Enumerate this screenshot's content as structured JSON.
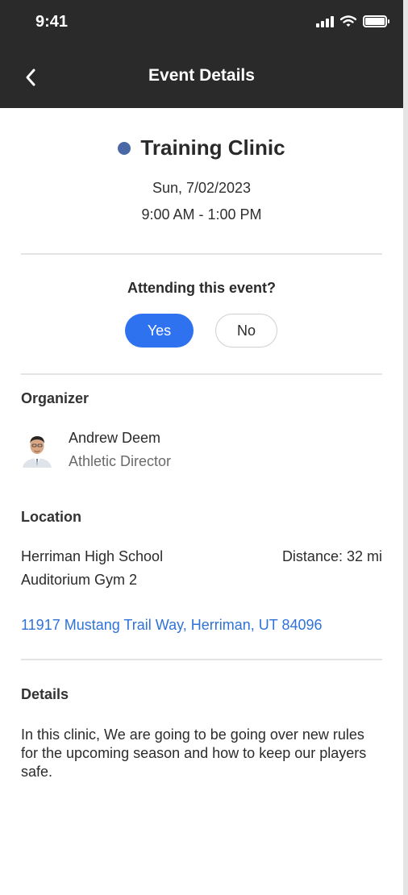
{
  "status_bar": {
    "time": "9:41"
  },
  "nav": {
    "title": "Event Details",
    "back_icon": "chevron-left-icon"
  },
  "event": {
    "title": "Training Clinic",
    "dot_color": "#4a67a6",
    "date": "Sun, 7/02/2023",
    "time_range": "9:00 AM - 1:00 PM"
  },
  "attendance": {
    "question": "Attending this event?",
    "yes_label": "Yes",
    "no_label": "No",
    "selected": "Yes",
    "accent": "#2f72f0"
  },
  "organizer": {
    "heading": "Organizer",
    "name": "Andrew Deem",
    "role": "Athletic Director"
  },
  "location": {
    "heading": "Location",
    "place": "Herriman High School",
    "room": "Auditorium Gym 2",
    "distance": "Distance: 32 mi",
    "address": "11917 Mustang Trail Way, Herriman, UT 84096",
    "link_color": "#2f72d8"
  },
  "details": {
    "heading": "Details",
    "text": "In this clinic, We are going to be going over new rules for the upcoming season and how to keep our players safe."
  }
}
